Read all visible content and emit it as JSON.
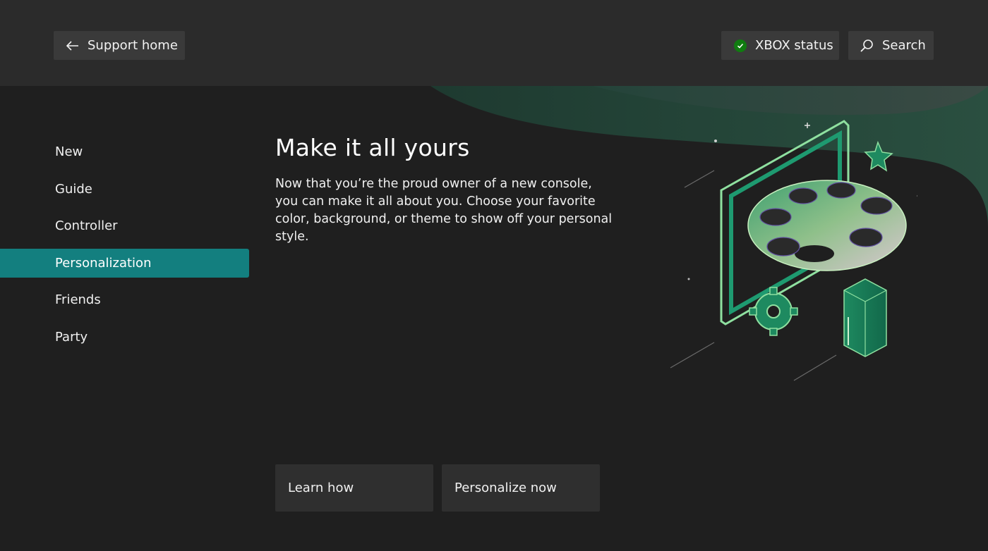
{
  "header": {
    "back_label": "Support home",
    "status_label": "XBOX status",
    "search_label": "Search"
  },
  "sidebar": {
    "items": [
      {
        "label": "New"
      },
      {
        "label": "Guide"
      },
      {
        "label": "Controller"
      },
      {
        "label": "Personalization",
        "active": true
      },
      {
        "label": "Friends"
      },
      {
        "label": "Party"
      }
    ]
  },
  "main": {
    "title": "Make it all yours",
    "description": "Now that you’re the proud owner of a new console, you can make it all about you. Choose your favorite color, background, or theme to show off your personal style.",
    "buttons": {
      "learn_label": "Learn how",
      "personalize_label": "Personalize now"
    }
  },
  "icons": {
    "back": "arrow-left-icon",
    "status": "check-circle-icon",
    "search": "search-icon",
    "illustration": "palette-illustration"
  },
  "colors": {
    "accent": "#137f7f",
    "status_ok": "#107c10",
    "background": "#1f1f1f",
    "header": "#2b2b2b"
  }
}
